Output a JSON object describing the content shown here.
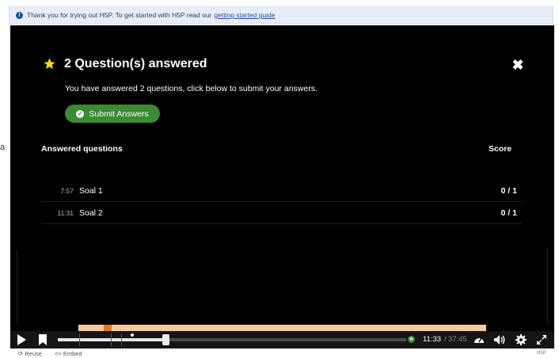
{
  "notice": {
    "text": "Thank you for trying out H5P. To get started with H5P read our",
    "link": "getting started guide"
  },
  "stray_text": "a",
  "summary": {
    "title": "2 Question(s) answered",
    "message": "You have answered 2 questions, click below to submit your answers.",
    "submit_label": "Submit Answers",
    "header_left": "Answered questions",
    "header_right": "Score",
    "rows": [
      {
        "time": "7:57",
        "name": "Soal 1",
        "score": "0 / 1"
      },
      {
        "time": "11:31",
        "name": "Soal 2",
        "score": "0 / 1"
      }
    ]
  },
  "controls": {
    "current_time": "11:33",
    "separator": "/",
    "total_time": "37:45",
    "progress": 0.31,
    "buffered": 0.21,
    "icons": [
      "play-icon",
      "bookmark-icon",
      "speed-icon",
      "volume-icon",
      "settings-icon",
      "fullscreen-icon"
    ]
  },
  "footer": {
    "reuse_label": "Reuse",
    "embed_label": "Embed",
    "brand": "H5P"
  },
  "colors": {
    "accent_green": "#3d8a34",
    "track": "#f6c9a2",
    "track_marker": "#d97a2c",
    "notice_bg": "#e8eef8"
  }
}
